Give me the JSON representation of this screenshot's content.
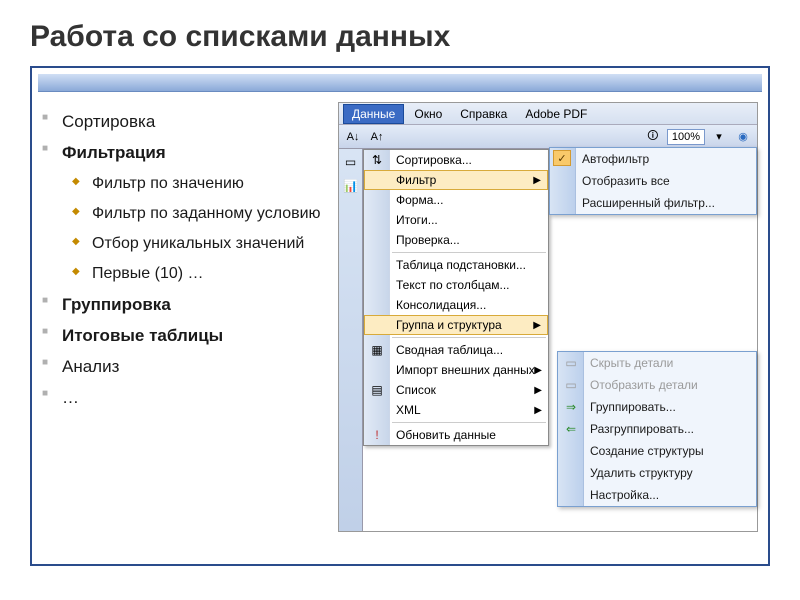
{
  "title": "Работа со списками данных",
  "bullets": {
    "b1": " Сортировка",
    "b2": "Фильтрация",
    "s1": "Фильтр по значению",
    "s2": "Фильтр по заданному условию",
    "s3": "Отбор уникальных значений",
    "s4": "Первые (10) …",
    "b3": "Группировка",
    "b4": "Итоговые таблицы",
    "b5": " Анализ",
    "b6": "…"
  },
  "menubar": {
    "m1": "Данные",
    "m2": "Окно",
    "m3": "Справка",
    "m4": "Adobe PDF"
  },
  "toolbar": {
    "zoom": "100%",
    "sort_az": "А↓",
    "sort_za": "А↑"
  },
  "dropdown": {
    "i1": "Сортировка...",
    "i2": "Фильтр",
    "i3": "Форма...",
    "i4": "Итоги...",
    "i5": "Проверка...",
    "i6": "Таблица подстановки...",
    "i7": "Текст по столбцам...",
    "i8": "Консолидация...",
    "i9": "Группа и структура",
    "i10": "Сводная таблица...",
    "i11": "Импорт внешних данных",
    "i12": "Список",
    "i13": "XML",
    "i14": "Обновить данные"
  },
  "submenu1": {
    "i1": "Автофильтр",
    "i2": "Отобразить все",
    "i3": "Расширенный фильтр..."
  },
  "submenu2": {
    "i1": "Скрыть детали",
    "i2": "Отобразить детали",
    "i3": "Группировать...",
    "i4": "Разгруппировать...",
    "i5": "Создание структуры",
    "i6": "Удалить структуру",
    "i7": "Настройка..."
  }
}
